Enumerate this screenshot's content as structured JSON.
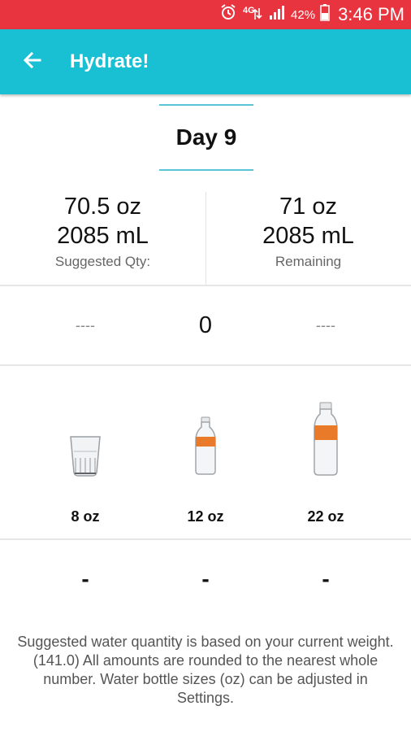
{
  "status_bar": {
    "battery": "42%",
    "time": "3:46 PM",
    "network": "4G",
    "icons": [
      "alarm-icon",
      "network-4g-icon",
      "signal-icon",
      "battery-icon"
    ]
  },
  "app_bar": {
    "title": "Hydrate!",
    "back_icon": "arrow-left-icon",
    "color": "#19bfd3"
  },
  "day": {
    "label": "Day 9"
  },
  "stats": {
    "suggested": {
      "oz": "70.5 oz",
      "ml": "2085 mL",
      "label": "Suggested Qty:"
    },
    "remaining": {
      "oz": "71 oz",
      "ml": "2085 mL",
      "label": "Remaining"
    }
  },
  "counter": {
    "left": "----",
    "value": "0",
    "right": "----"
  },
  "containers": [
    {
      "icon": "glass-icon",
      "label": "8 oz"
    },
    {
      "icon": "small-bottle-icon",
      "label": "12 oz"
    },
    {
      "icon": "large-bottle-icon",
      "label": "22 oz"
    }
  ],
  "remove_buttons": [
    "-",
    "-",
    "-"
  ],
  "note": "Suggested water quantity is based on your current weight. (141.0)  All amounts are rounded to the nearest whole number. Water bottle sizes (oz) can be adjusted in Settings.",
  "colors": {
    "status_bar": "#e8343f",
    "accent": "#5ac6d8",
    "bottle_label": "#e87a2a"
  }
}
